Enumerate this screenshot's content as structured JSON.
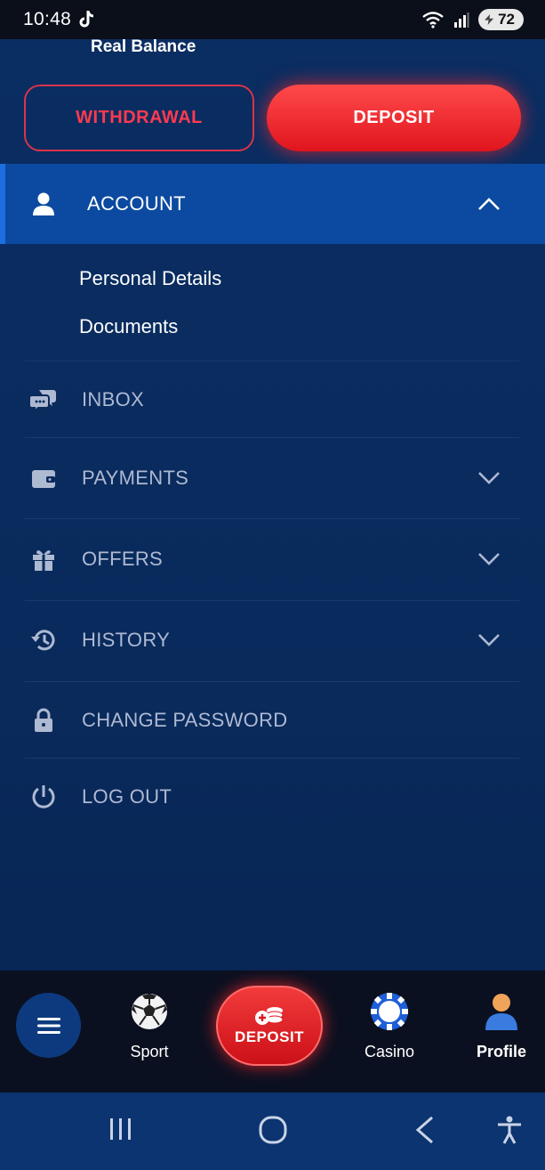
{
  "status": {
    "time": "10:48",
    "battery": "72"
  },
  "balance": {
    "label": "Real Balance"
  },
  "actions": {
    "withdrawal": "WITHDRAWAL",
    "deposit": "DEPOSIT"
  },
  "menu": {
    "account": "ACCOUNT",
    "account_sub": [
      "Personal Details",
      "Documents"
    ],
    "inbox": "INBOX",
    "payments": "PAYMENTS",
    "offers": "OFFERS",
    "history": "HISTORY",
    "change_password": "CHANGE PASSWORD",
    "logout": "LOG OUT"
  },
  "bottom_nav": {
    "sport": "Sport",
    "deposit": "DEPOSIT",
    "casino": "Casino",
    "profile": "Profile"
  },
  "colors": {
    "accent_red": "#e0151e",
    "active_blue": "#0b4aa0",
    "background": "#0a2a5c"
  }
}
